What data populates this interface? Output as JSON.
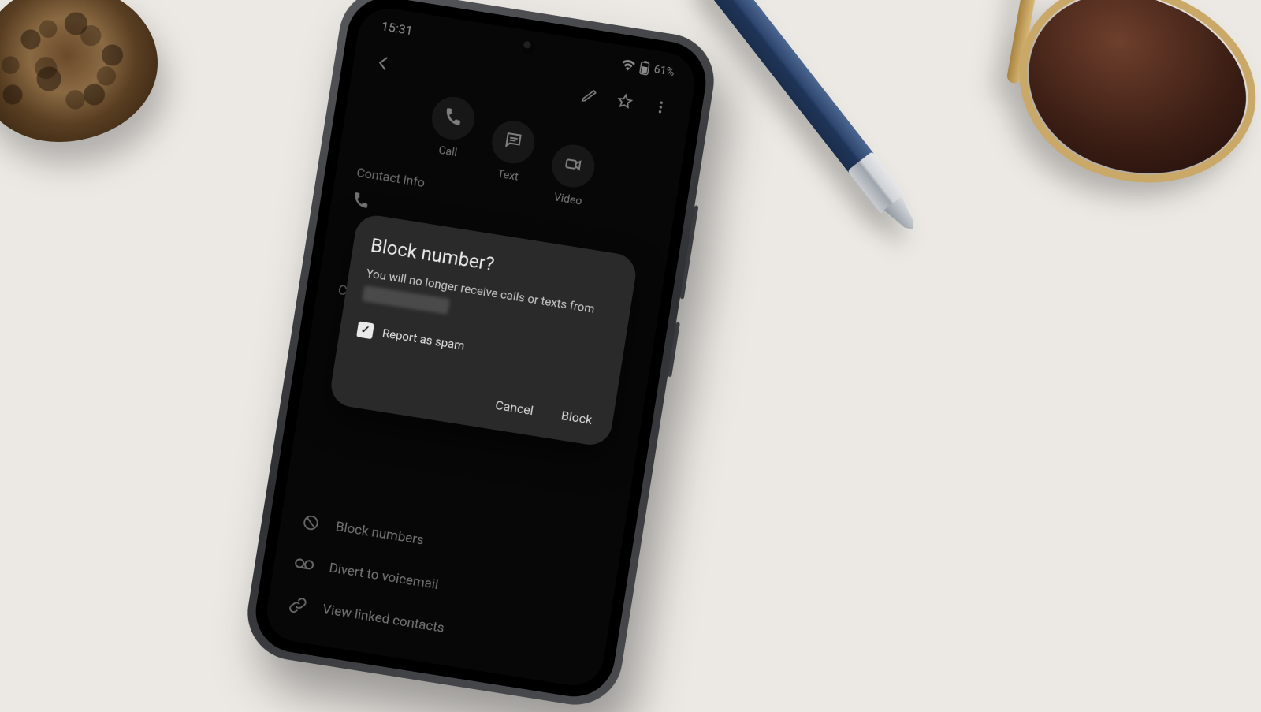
{
  "status": {
    "time": "15:31",
    "battery": "61%"
  },
  "header": {
    "edit_icon": "pencil-icon",
    "favorite_icon": "star-outline-icon",
    "overflow_icon": "more-vertical-icon"
  },
  "actions": {
    "call": {
      "label": "Call",
      "icon": "phone-icon"
    },
    "text": {
      "label": "Text",
      "icon": "message-icon"
    },
    "video": {
      "label": "Video",
      "icon": "video-icon"
    }
  },
  "section_contact_info": "Contact info",
  "list": {
    "block": "Block numbers",
    "divert": "Divert to voicemail",
    "linked": "View linked contacts"
  },
  "hidden_prefix": "Co",
  "dialog": {
    "title": "Block number?",
    "body": "You will no longer receive calls or texts from",
    "report_spam": "Report as spam",
    "cancel": "Cancel",
    "confirm": "Block",
    "spam_checked": true
  }
}
